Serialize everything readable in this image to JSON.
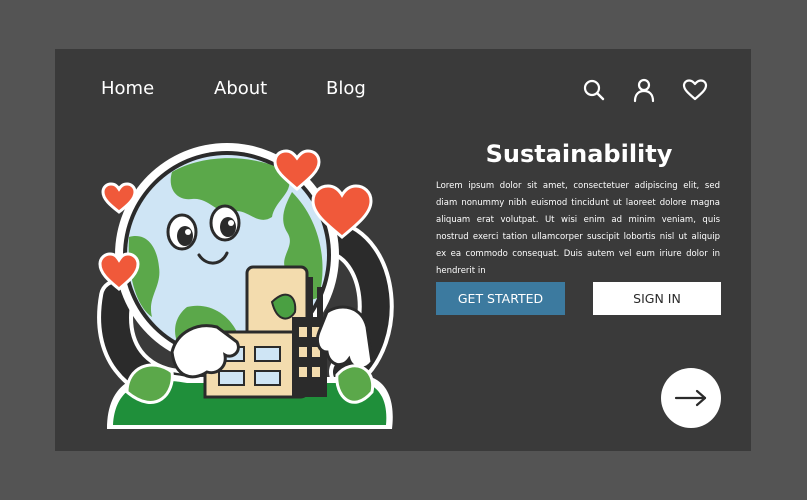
{
  "nav": {
    "links": [
      "Home",
      "About",
      "Blog"
    ],
    "icons": [
      "search-icon",
      "user-icon",
      "heart-icon"
    ]
  },
  "hero": {
    "title": "Sustainability",
    "body": "Lorem ipsum dolor sit amet, consectetuer adipiscing elit, sed diam nonummy nibh euismod tincidunt ut laoreet dolore magna aliquam erat volutpat. Ut wisi enim ad minim veniam, quis nostrud exerci tation ullamcorper suscipit lobortis nisl ut aliquip ex ea commodo consequat. Duis autem vel eum iriure dolor in hendrerit in",
    "primary_button": "GET STARTED",
    "secondary_button": "SIGN IN"
  },
  "next_icon": "arrow-right-icon",
  "illustration_icon": "earth-factory-illustration",
  "colors": {
    "page_bg": "#545454",
    "card_bg": "#3a3a3a",
    "accent": "#3c7a9f",
    "heart": "#f0593a",
    "earth_green": "#5ba84a",
    "earth_water": "#cfe5f5"
  }
}
